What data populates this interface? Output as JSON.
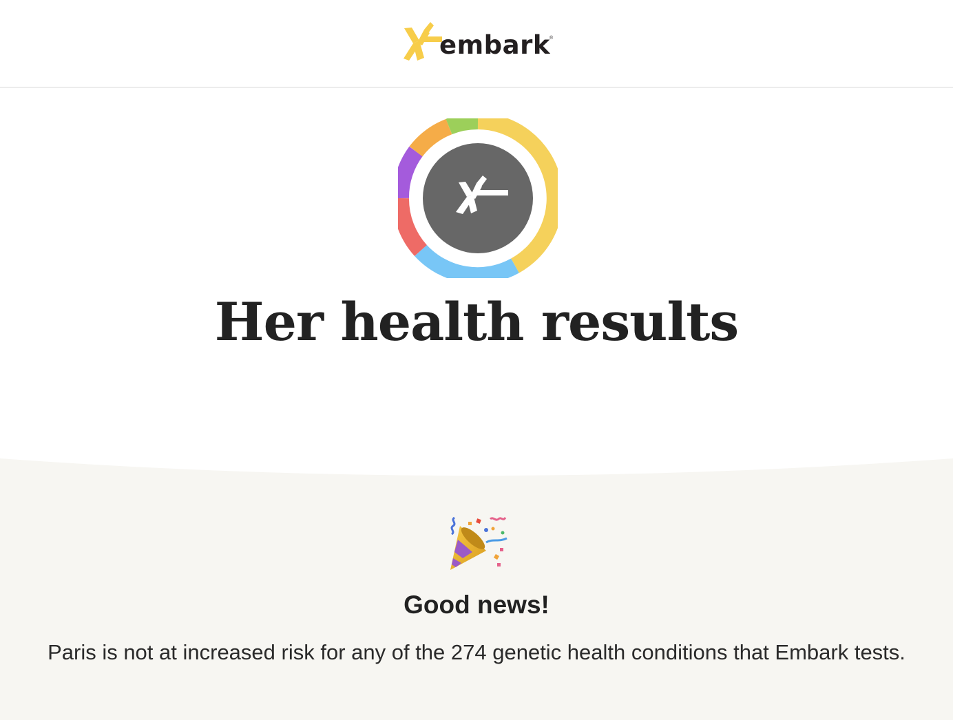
{
  "header": {
    "brand_name": "embark",
    "registered_mark": "®"
  },
  "hero": {
    "icon": "embark-health-ring-icon",
    "title": "Her health results"
  },
  "summary": {
    "icon": "party-popper-icon",
    "heading": "Good news!",
    "message": "Paris is not at increased risk for any of the 274 genetic health conditions that Embark tests."
  },
  "colors": {
    "brand_yellow": "#f7cd4a",
    "ring_center": "#676767",
    "ring_yellow": "#f5d15b",
    "ring_blue": "#78c6f6",
    "ring_red": "#ee6b66",
    "ring_purple": "#a45bdc",
    "ring_orange": "#f5ac48",
    "ring_green": "#9ccf5a",
    "section_bg": "#f7f6f2"
  }
}
